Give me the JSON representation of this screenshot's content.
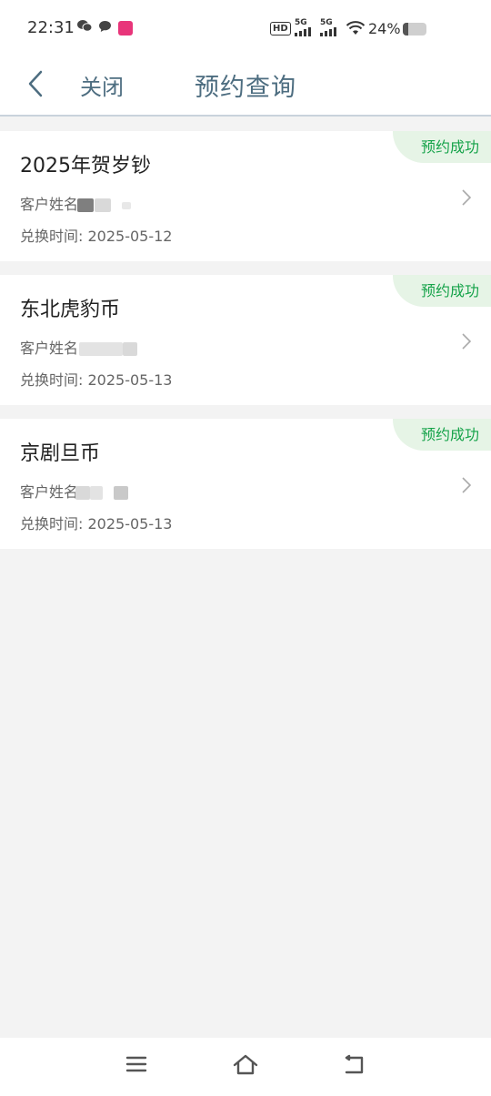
{
  "status_bar": {
    "time": "22:31",
    "network_hd": "HD",
    "signal_1": "5G",
    "signal_2": "5G",
    "battery_percent": "24%",
    "battery_level": 0.24
  },
  "header": {
    "close_label": "关闭",
    "title": "预约查询"
  },
  "records": [
    {
      "title": "2025年贺岁钞",
      "customer_label": "客户姓名:",
      "exchange_time": "兑换时间: 2025-05-12",
      "status": "预约成功"
    },
    {
      "title": "东北虎豹币",
      "customer_label": "客户姓名:",
      "exchange_time": "兑换时间: 2025-05-13",
      "status": "预约成功"
    },
    {
      "title": "京剧旦币",
      "customer_label": "客户姓名:",
      "exchange_time": "兑换时间: 2025-05-13",
      "status": "预约成功"
    }
  ],
  "colors": {
    "accent_header": "#4d6d80",
    "status_green": "#16a34a",
    "status_badge_bg": "#e6f4e6",
    "page_bg": "#f3f3f3"
  },
  "icons": {
    "back": "chevron-left-icon",
    "card_arrow": "chevron-right-icon",
    "nav_menu": "menu-icon",
    "nav_home": "home-icon",
    "nav_back": "back-icon"
  }
}
